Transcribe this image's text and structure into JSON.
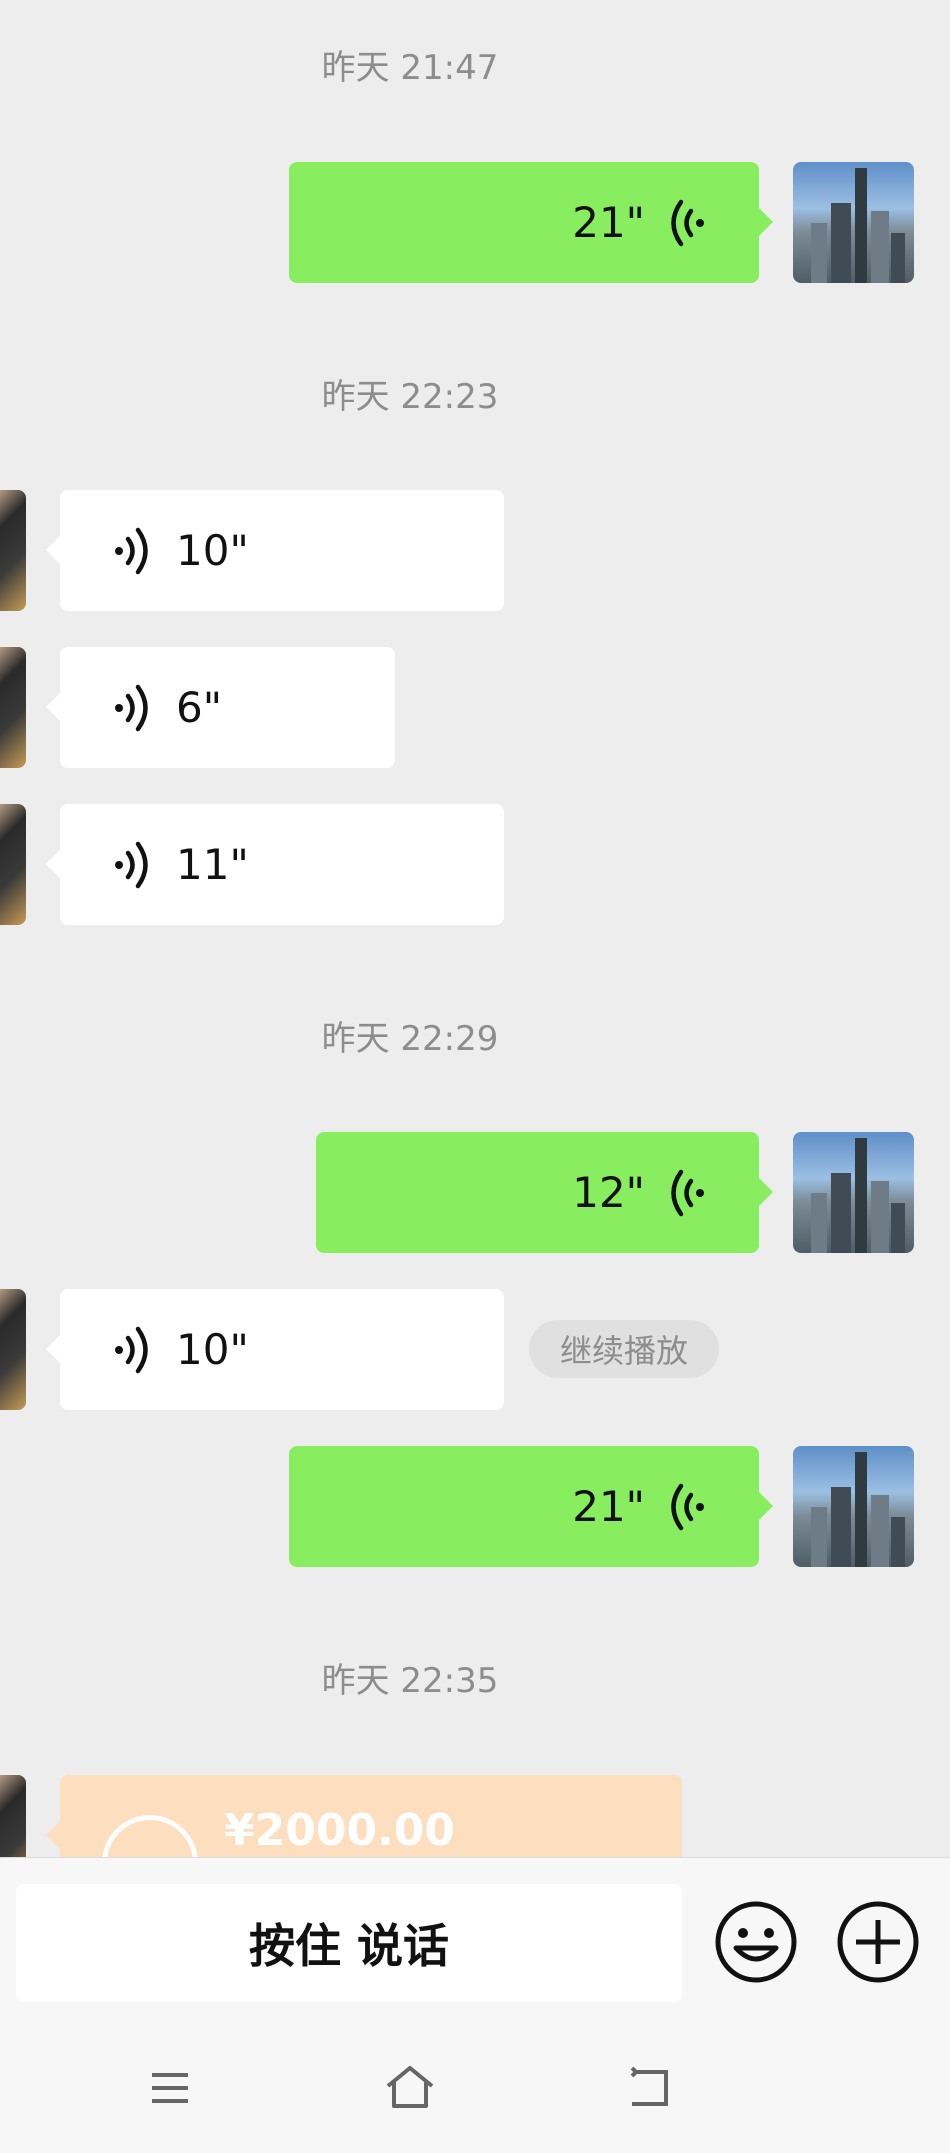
{
  "chat": {
    "timestamps": [
      "昨天 21:47",
      "昨天 22:23",
      "昨天 22:29",
      "昨天 22:35"
    ],
    "messages": [
      {
        "direction": "sent",
        "duration": "21\""
      },
      {
        "direction": "received",
        "duration": "10\""
      },
      {
        "direction": "received",
        "duration": "6\""
      },
      {
        "direction": "received",
        "duration": "11\""
      },
      {
        "direction": "sent",
        "duration": "12\""
      },
      {
        "direction": "received",
        "duration": "10\""
      },
      {
        "direction": "sent",
        "duration": "21\""
      }
    ],
    "continue_play_label": "继续播放",
    "transfer": {
      "amount": "¥2000.00"
    }
  },
  "input_bar": {
    "hold_to_talk_label": "按住 说话",
    "emoji_icon": "emoji-icon",
    "more_icon": "plus-icon"
  },
  "navbar": {
    "icons": [
      "menu-icon",
      "home-icon",
      "back-icon"
    ]
  },
  "colors": {
    "background": "#ededed",
    "sent_bubble": "#89ed60",
    "received_bubble": "#ffffff",
    "timestamp": "#8d8d8d",
    "transfer_bubble": "#fddfbf"
  }
}
